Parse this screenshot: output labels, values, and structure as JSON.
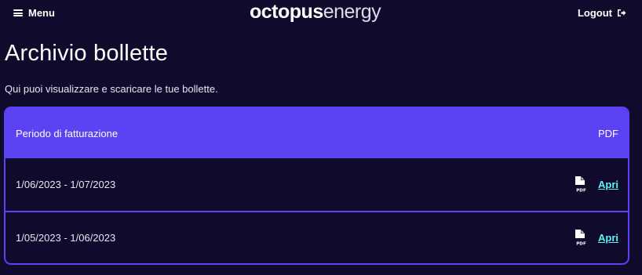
{
  "header": {
    "menu_label": "Menu",
    "logo_bold": "octopus",
    "logo_light": "energy",
    "logout_label": "Logout"
  },
  "page": {
    "title": "Archivio bollette",
    "subtitle": "Qui puoi visualizzare e scaricare le tue bollette."
  },
  "table": {
    "columns": [
      "Periodo di fatturazione",
      "PDF"
    ],
    "rows": [
      {
        "period": "1/06/2023 - 1/07/2023",
        "pdf_icon": "pdf-file-icon",
        "action": "Apri"
      },
      {
        "period": "1/05/2023 - 1/06/2023",
        "pdf_icon": "pdf-file-icon",
        "action": "Apri"
      }
    ]
  },
  "colors": {
    "background": "#100a2d",
    "accent": "#5b42f3",
    "link": "#60f0f8"
  }
}
